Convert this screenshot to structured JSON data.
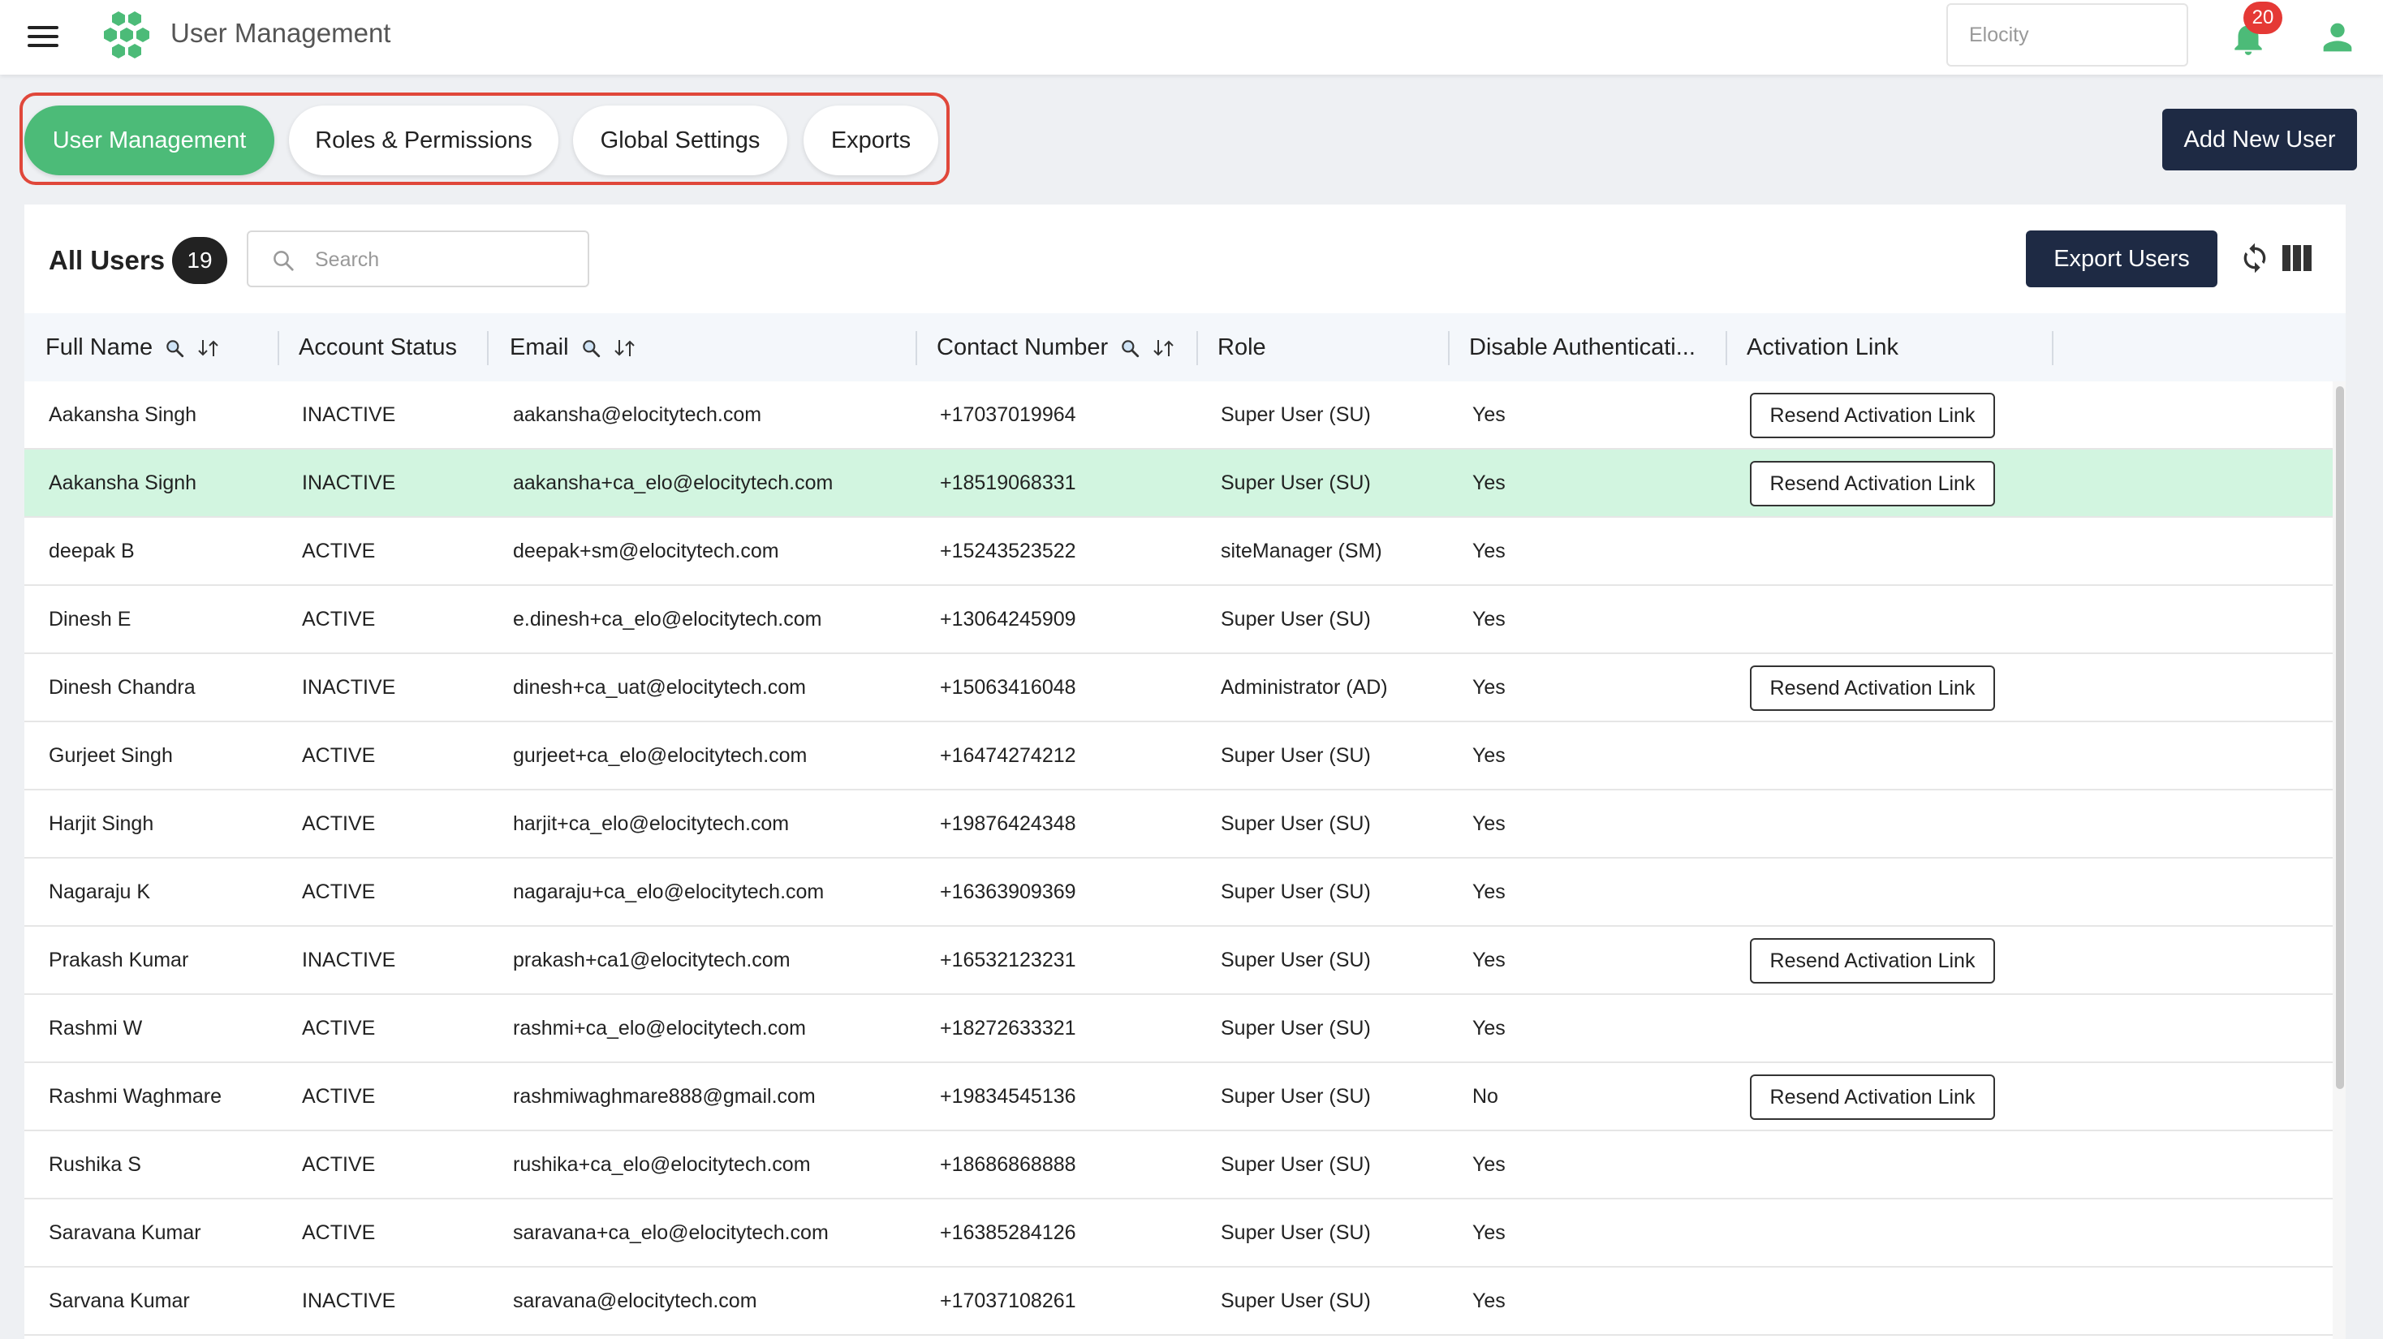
{
  "header": {
    "app_title": "User Management",
    "tenant_placeholder": "Elocity",
    "notification_count": "20"
  },
  "tabs": [
    {
      "label": "User Management",
      "active": true
    },
    {
      "label": "Roles & Permissions",
      "active": false
    },
    {
      "label": "Global Settings",
      "active": false
    },
    {
      "label": "Exports",
      "active": false
    }
  ],
  "add_user_label": "Add New User",
  "users_panel": {
    "title": "All Users",
    "count": "19",
    "search_placeholder": "Search",
    "export_label": "Export Users"
  },
  "table": {
    "columns": [
      "Full Name",
      "Account Status",
      "Email",
      "Contact Number",
      "Role",
      "Disable Authenticati...",
      "Activation Link"
    ],
    "resend_label": "Resend Activation Link",
    "rows": [
      {
        "name": "Aakansha Singh",
        "status": "INACTIVE",
        "email": "aakansha@elocitytech.com",
        "phone": "+17037019964",
        "role": "Super User (SU)",
        "disable_auth": "Yes",
        "resend": true
      },
      {
        "name": "Aakansha Signh",
        "status": "INACTIVE",
        "email": "aakansha+ca_elo@elocitytech.com",
        "phone": "+18519068331",
        "role": "Super User (SU)",
        "disable_auth": "Yes",
        "resend": true
      },
      {
        "name": "deepak B",
        "status": "ACTIVE",
        "email": "deepak+sm@elocitytech.com",
        "phone": "+15243523522",
        "role": "siteManager (SM)",
        "disable_auth": "Yes",
        "resend": false
      },
      {
        "name": "Dinesh E",
        "status": "ACTIVE",
        "email": "e.dinesh+ca_elo@elocitytech.com",
        "phone": "+13064245909",
        "role": "Super User (SU)",
        "disable_auth": "Yes",
        "resend": false
      },
      {
        "name": "Dinesh Chandra",
        "status": "INACTIVE",
        "email": "dinesh+ca_uat@elocitytech.com",
        "phone": "+15063416048",
        "role": "Administrator (AD)",
        "disable_auth": "Yes",
        "resend": true
      },
      {
        "name": "Gurjeet Singh",
        "status": "ACTIVE",
        "email": "gurjeet+ca_elo@elocitytech.com",
        "phone": "+16474274212",
        "role": "Super User (SU)",
        "disable_auth": "Yes",
        "resend": false
      },
      {
        "name": "Harjit Singh",
        "status": "ACTIVE",
        "email": "harjit+ca_elo@elocitytech.com",
        "phone": "+19876424348",
        "role": "Super User (SU)",
        "disable_auth": "Yes",
        "resend": false
      },
      {
        "name": "Nagaraju K",
        "status": "ACTIVE",
        "email": "nagaraju+ca_elo@elocitytech.com",
        "phone": "+16363909369",
        "role": "Super User (SU)",
        "disable_auth": "Yes",
        "resend": false
      },
      {
        "name": "Prakash Kumar",
        "status": "INACTIVE",
        "email": "prakash+ca1@elocitytech.com",
        "phone": "+16532123231",
        "role": "Super User (SU)",
        "disable_auth": "Yes",
        "resend": true
      },
      {
        "name": "Rashmi W",
        "status": "ACTIVE",
        "email": "rashmi+ca_elo@elocitytech.com",
        "phone": "+18272633321",
        "role": "Super User (SU)",
        "disable_auth": "Yes",
        "resend": false
      },
      {
        "name": "Rashmi Waghmare",
        "status": "ACTIVE",
        "email": "rashmiwaghmare888@gmail.com",
        "phone": "+19834545136",
        "role": "Super User (SU)",
        "disable_auth": "No",
        "resend": true
      },
      {
        "name": "Rushika S",
        "status": "ACTIVE",
        "email": "rushika+ca_elo@elocitytech.com",
        "phone": "+18686868888",
        "role": "Super User (SU)",
        "disable_auth": "Yes",
        "resend": false
      },
      {
        "name": "Saravana Kumar",
        "status": "ACTIVE",
        "email": "saravana+ca_elo@elocitytech.com",
        "phone": "+16385284126",
        "role": "Super User (SU)",
        "disable_auth": "Yes",
        "resend": false
      },
      {
        "name": "Sarvana Kumar",
        "status": "INACTIVE",
        "email": "saravana@elocitytech.com",
        "phone": "+17037108261",
        "role": "Super User (SU)",
        "disable_auth": "Yes",
        "resend": false
      }
    ]
  },
  "icons": {
    "menu": "menu-icon",
    "logo": "hexagon-logo-icon",
    "bell": "bell-icon",
    "user": "user-icon",
    "search": "search-icon",
    "filter": "magnifier-icon",
    "sort": "sort-arrows-icon",
    "refresh": "refresh-icon",
    "columns": "columns-icon"
  },
  "colors": {
    "accent_green": "#4cbb78",
    "highlight_row": "#d2f5e0",
    "dark_button": "#1e2a44",
    "tab_outline": "#e0473a",
    "badge_red": "#e53935"
  }
}
